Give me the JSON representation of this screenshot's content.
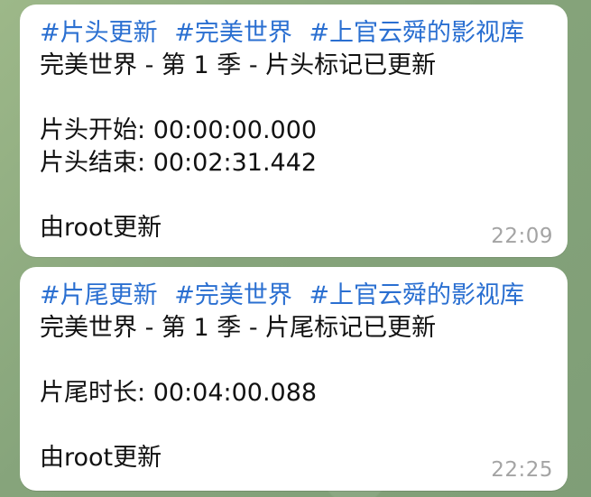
{
  "messages": [
    {
      "tags": [
        "#片头更新",
        "#完美世界",
        "#上官云舜的影视库"
      ],
      "title": "完美世界 - 第 1 季 - 片头标记已更新",
      "fields": [
        {
          "label": "片头开始",
          "value": "00:00:00.000"
        },
        {
          "label": "片头结束",
          "value": "00:02:31.442"
        }
      ],
      "footer": "由root更新",
      "time": "22:09"
    },
    {
      "tags": [
        "#片尾更新",
        "#完美世界",
        "#上官云舜的影视库"
      ],
      "title": "完美世界 - 第 1 季 - 片尾标记已更新",
      "fields": [
        {
          "label": "片尾时长",
          "value": "00:04:00.088"
        }
      ],
      "footer": "由root更新",
      "time": "22:25"
    }
  ]
}
